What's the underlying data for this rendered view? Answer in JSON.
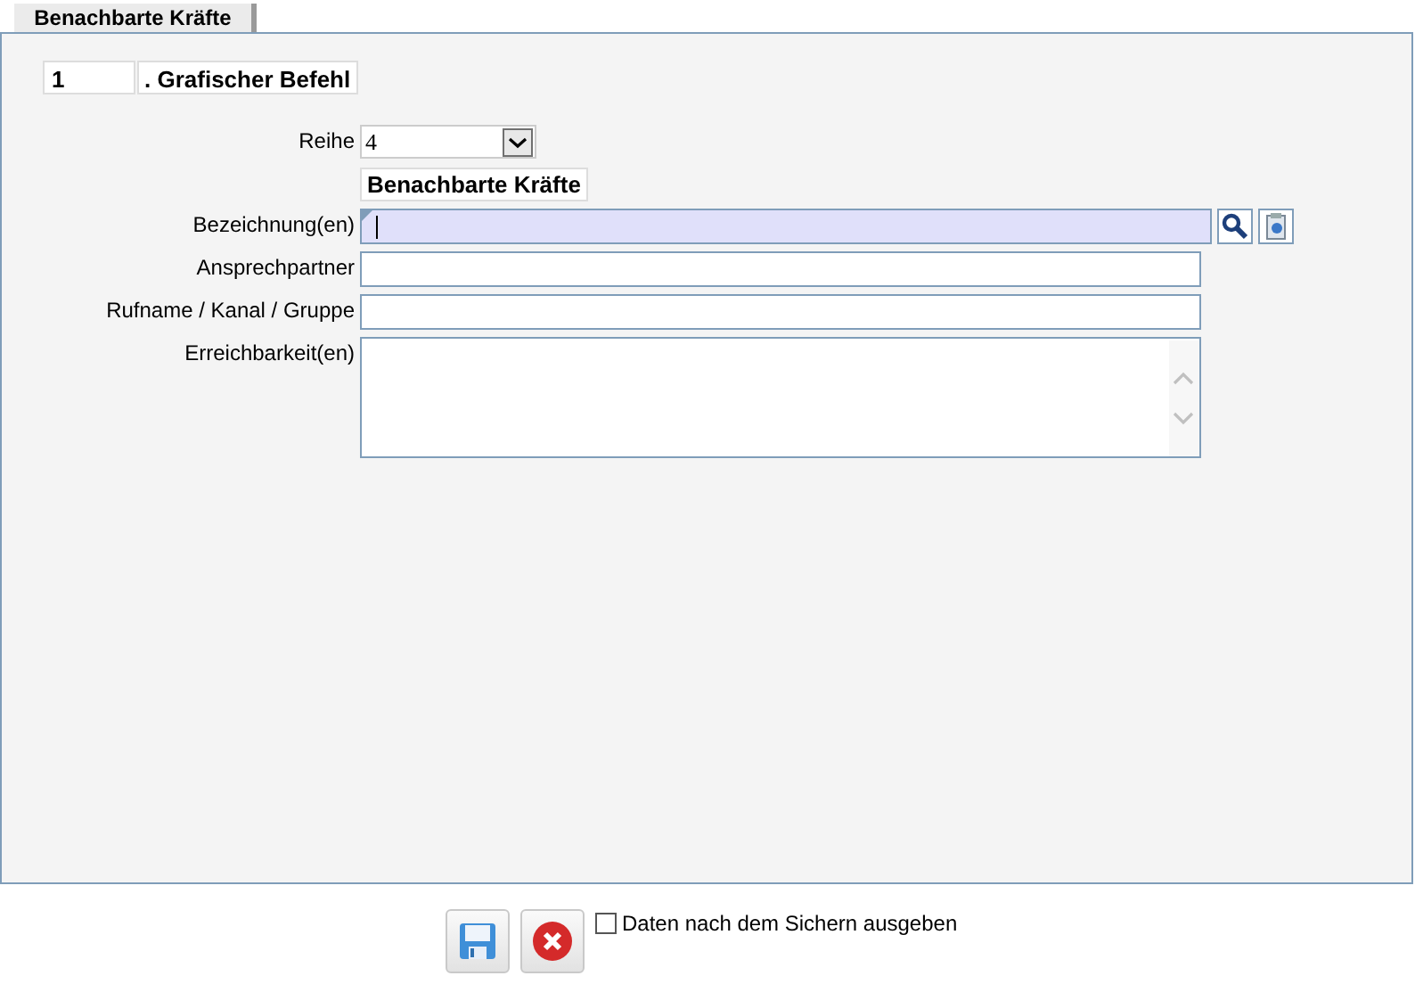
{
  "tabs": [
    {
      "label": "Benachbarte Kräfte",
      "selected": true
    }
  ],
  "command": {
    "number": "1",
    "label": ". Grafischer Befehl"
  },
  "fields": [
    {
      "kind": "select",
      "label": "Reihe",
      "value": "4",
      "caption": "Benachbarte Kräfte"
    },
    {
      "kind": "lookup",
      "label": "Bezeichnung(en)",
      "focused": true
    },
    {
      "kind": "text",
      "label": "Ansprechpartner",
      "focused": false
    },
    {
      "kind": "text",
      "label": "Rufname / Kanal / Gruppe",
      "focused": false
    },
    {
      "kind": "textarea",
      "label": "Erreichbarkeit(en)",
      "focused": false
    }
  ],
  "footer": {
    "checkbox": {
      "label": "Daten nach dem Sichern ausgeben",
      "checked": false
    }
  }
}
